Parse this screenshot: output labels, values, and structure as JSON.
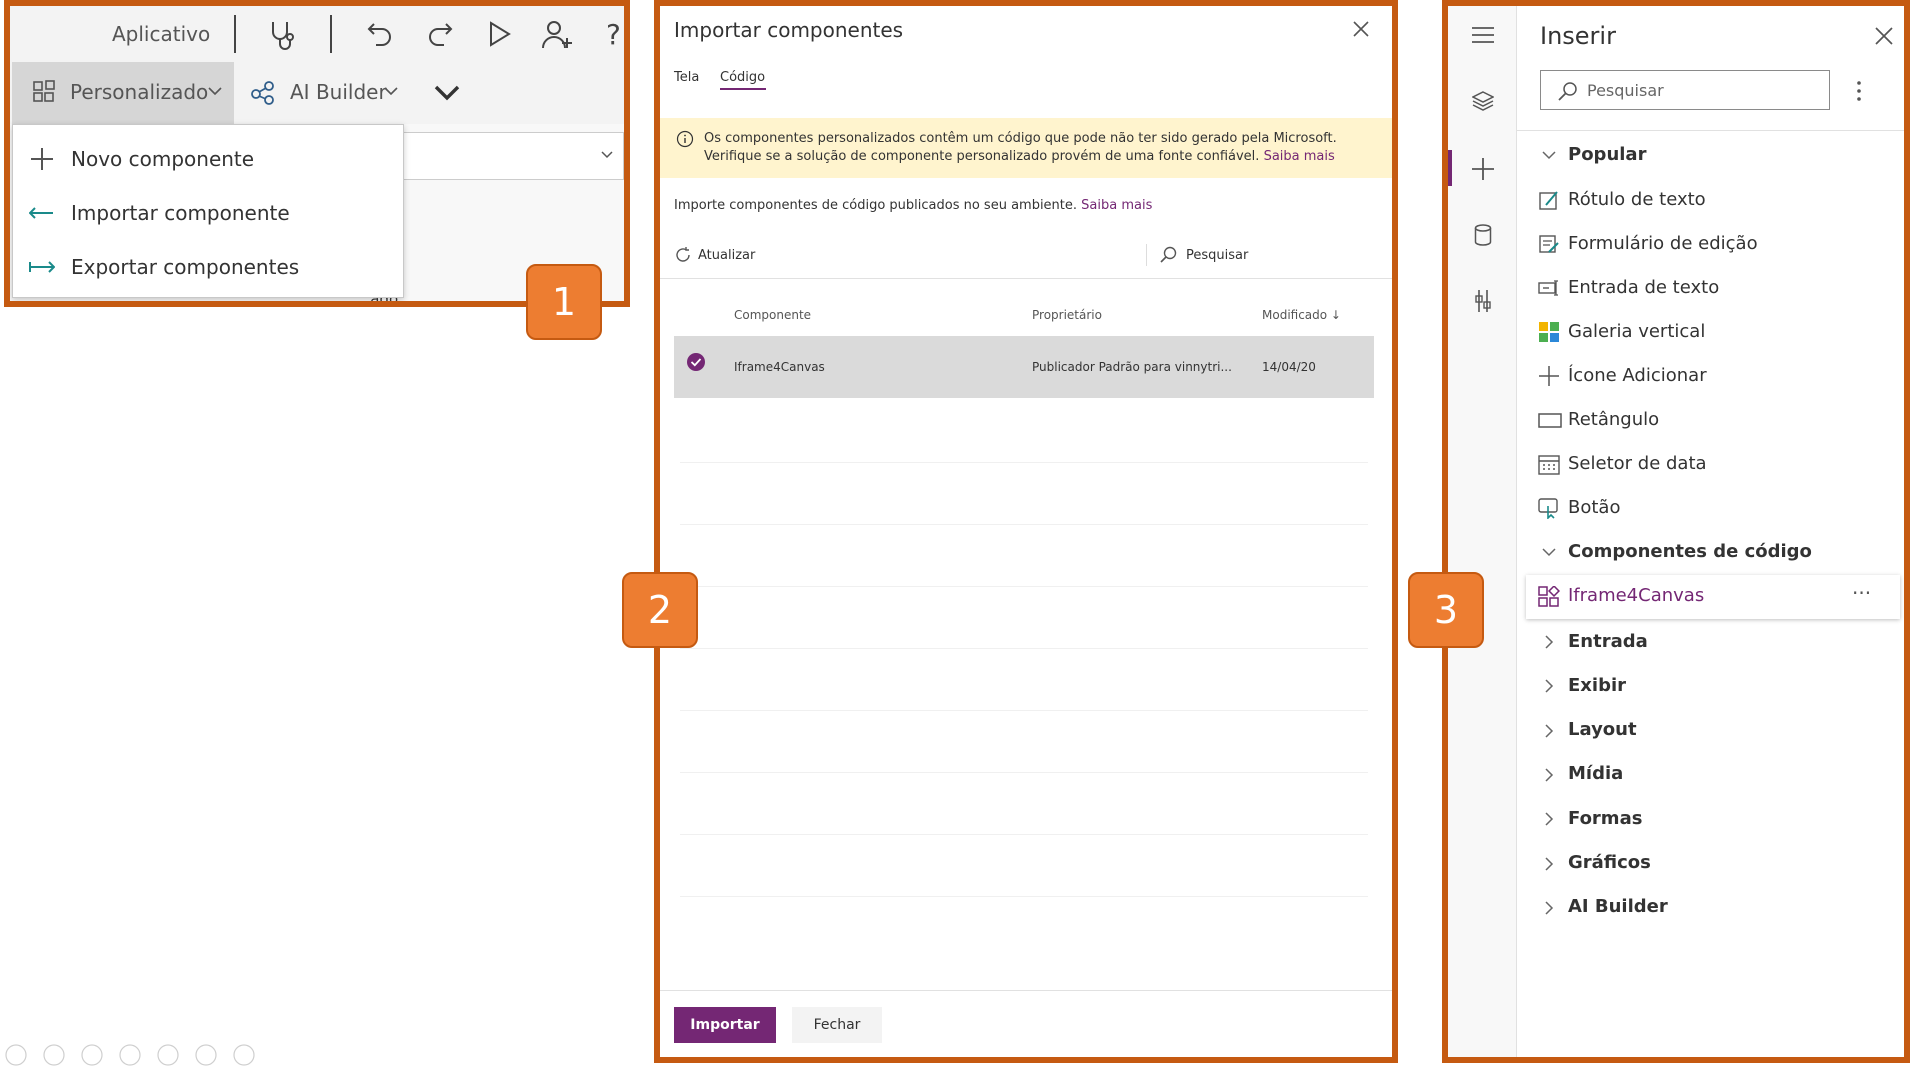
{
  "panel1": {
    "tabs": [
      "Aplicativo"
    ],
    "custom_label": "Personalizado",
    "ai_builder_label": "AI Builder",
    "help_char": "?",
    "menu_items": [
      "Novo componente",
      "Importar componente",
      "Exportar componentes"
    ],
    "partial_text": "...ado"
  },
  "panel2": {
    "title": "Importar componentes",
    "tabs": [
      "Tela",
      "Código"
    ],
    "warning_text": "Os componentes personalizados contêm um código que pode não ter sido gerado pela Microsoft. Verifique se a solução de componente personalizado provém de uma fonte confiável.",
    "warning_link": "Saiba mais",
    "info_text": "Importe componentes de código publicados no seu ambiente.",
    "info_link": "Saiba mais",
    "refresh_label": "Atualizar",
    "search_label": "Pesquisar",
    "columns": [
      "Componente",
      "Proprietário",
      "Modificado ↓"
    ],
    "rows": [
      {
        "component": "Iframe4Canvas",
        "owner": "Publicador Padrão para vinnytri...",
        "modified": "14/04/20"
      }
    ],
    "import_button": "Importar",
    "close_button": "Fechar"
  },
  "panel3": {
    "title": "Inserir",
    "search_placeholder": "Pesquisar",
    "popular_label": "Popular",
    "popular_items": [
      "Rótulo de texto",
      "Formulário de edição",
      "Entrada de texto",
      "Galeria vertical",
      "Ícone Adicionar",
      "Retângulo",
      "Seletor de data",
      "Botão"
    ],
    "code_components_label": "Componentes de código",
    "code_component": "Iframe4Canvas",
    "more_label": "···",
    "categories": [
      "Entrada",
      "Exibir",
      "Layout",
      "Mídia",
      "Formas",
      "Gráficos",
      "AI Builder"
    ]
  },
  "callouts": [
    "1",
    "2",
    "3"
  ],
  "colors": {
    "frame": "#c55a11",
    "callout": "#ed7d31",
    "accent": "#742774",
    "warning_bg": "#fff4ce"
  }
}
